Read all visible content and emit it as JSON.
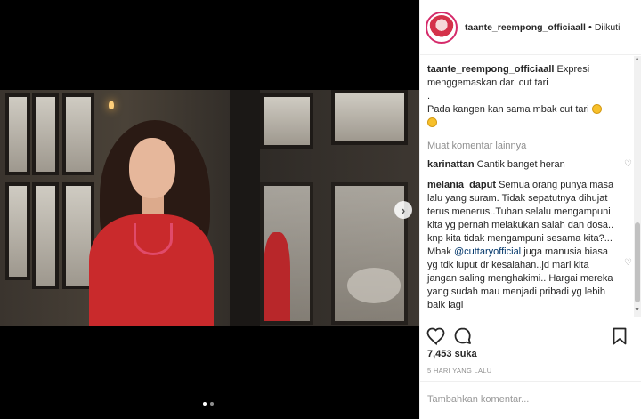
{
  "post": {
    "username": "taante_reempong_officiaall",
    "separator": "•",
    "follow_status": "Diikuti"
  },
  "caption": {
    "user": "taante_reempong_officiaall",
    "line1": "Expresi",
    "line2": "menggemaskan dari cut tari",
    "line3": ".",
    "line4": "Pada kangen kan sama mbak cut tari"
  },
  "load_more": "Muat komentar lainnya",
  "comments": [
    {
      "user": "karinattan",
      "text": "Cantik banget heran"
    },
    {
      "user": "melania_daput",
      "text_before": "Semua orang punya masa lalu yang suram. Tidak sepatutnya dihujat terus menerus..Tuhan selalu mengampuni kita yg pernah melakukan salah dan dosa.. knp kita tidak mengampuni sesama kita?... Mbak ",
      "mention": "@cuttaryofficial",
      "text_after": " juga manusia biasa yg tdk luput dr kesalahan..jd mari kita jangan saling menghakimi.. Hargai mereka yang sudah mau menjadi pribadi yg lebih baik lagi"
    }
  ],
  "likes": "7,453 suka",
  "time": "5 HARI YANG LALU",
  "add_comment": {
    "placeholder": "Tambahkan komentar..."
  },
  "icons": {
    "like": "heart-icon",
    "comment": "comment-icon",
    "save": "bookmark-icon",
    "next": "chevron-right-icon"
  },
  "carousel": {
    "count": 2,
    "active": 1,
    "next_glyph": "›"
  },
  "colors": {
    "avatar_ring": "#d52a6a",
    "mention": "#003569",
    "muted": "#8e8e8e"
  }
}
